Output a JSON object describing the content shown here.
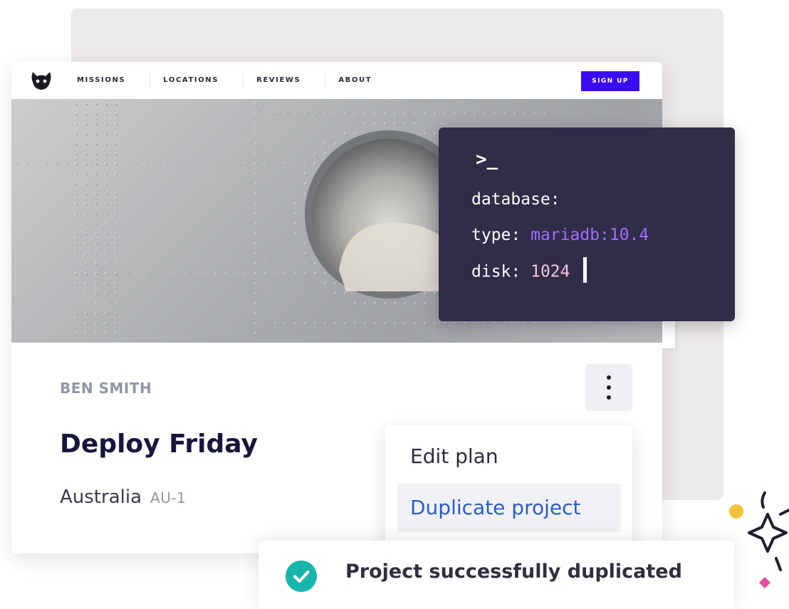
{
  "navbar": {
    "links": [
      "MISSIONS",
      "LOCATIONS",
      "REVIEWS",
      "ABOUT"
    ],
    "signup_label": "SIGN UP",
    "logo_icon": "cat-head-icon"
  },
  "terminal": {
    "prompt": ">_",
    "line1_key": "database:",
    "line2_key": "type:",
    "line2_value": "mariadb:10.4",
    "line3_key": "disk:",
    "line3_value": "1024"
  },
  "project": {
    "author": "BEN SMITH",
    "title": "Deploy Friday",
    "location": "Australia",
    "region": "AU-1"
  },
  "menu": {
    "items": [
      "Edit plan",
      "Duplicate project"
    ]
  },
  "toast": {
    "message": "Project successfully duplicated",
    "icon": "check-circle-icon"
  },
  "colors": {
    "accent": "#3b0cf2",
    "terminal_bg": "#302d48",
    "terminal_purple": "#a36bff",
    "terminal_pink": "#f7c6d8",
    "link_blue": "#2a5cc9",
    "success": "#18b5ad",
    "sparkle_yellow": "#f5c23e",
    "sparkle_pink": "#e04fa0"
  }
}
